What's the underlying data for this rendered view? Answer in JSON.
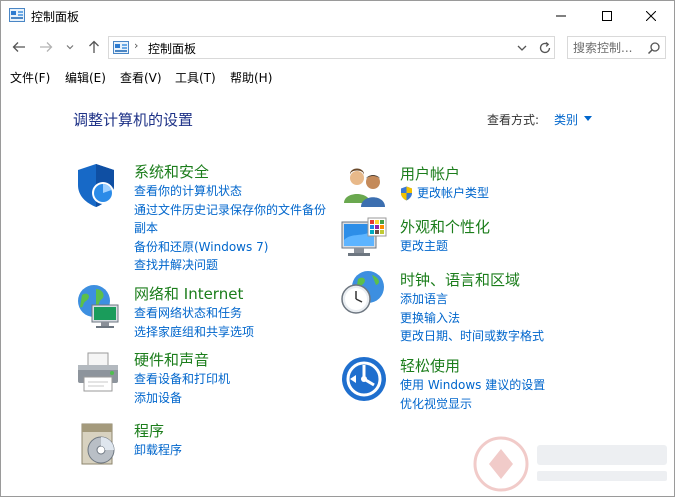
{
  "window": {
    "title": "控制面板"
  },
  "address": {
    "path": "控制面板",
    "separator": "›"
  },
  "search": {
    "placeholder": "搜索控制..."
  },
  "menu": [
    "文件(F)",
    "编辑(E)",
    "查看(V)",
    "工具(T)",
    "帮助(H)"
  ],
  "heading": "调整计算机的设置",
  "view_by": {
    "label": "查看方式:",
    "value": "类别"
  },
  "left_categories": [
    {
      "title": "系统和安全",
      "links": [
        "查看你的计算机状态",
        "通过文件历史记录保存你的文件备份",
        "副本",
        "备份和还原(Windows 7)",
        "查找并解决问题"
      ]
    },
    {
      "title": "网络和 Internet",
      "links": [
        "查看网络状态和任务",
        "选择家庭组和共享选项"
      ]
    },
    {
      "title": "硬件和声音",
      "links": [
        "查看设备和打印机",
        "添加设备"
      ]
    },
    {
      "title": "程序",
      "links": [
        "卸载程序"
      ]
    }
  ],
  "right_categories": [
    {
      "title": "用户帐户",
      "links": [
        "更改帐户类型"
      ]
    },
    {
      "title": "外观和个性化",
      "links": [
        "更改主题"
      ]
    },
    {
      "title": "时钟、语言和区域",
      "links": [
        "添加语言",
        "更换输入法",
        "更改日期、时间或数字格式"
      ]
    },
    {
      "title": "轻松使用",
      "links": [
        "使用 Windows 建议的设置",
        "优化视觉显示"
      ]
    }
  ],
  "colors": {
    "heading": "#1e3287",
    "category_title": "#1b7d1b",
    "link": "#0066cc"
  },
  "icons": [
    "control-panel-icon",
    "back-arrow-icon",
    "forward-arrow-icon",
    "chevron-down-icon",
    "up-arrow-icon",
    "refresh-icon",
    "search-icon",
    "shield-icon",
    "network-globe-icon",
    "printer-icon",
    "programs-disc-icon",
    "users-icon",
    "monitor-palette-icon",
    "clock-globe-icon",
    "ease-of-access-icon"
  ]
}
